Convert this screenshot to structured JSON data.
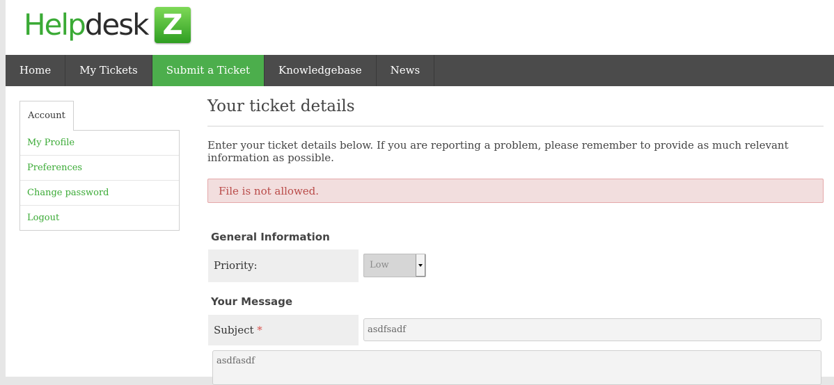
{
  "logo": {
    "part1": "Help",
    "part2": "desk",
    "badge": "Z"
  },
  "nav": {
    "items": [
      {
        "label": "Home"
      },
      {
        "label": "My Tickets"
      },
      {
        "label": "Submit a Ticket"
      },
      {
        "label": "Knowledgebase"
      },
      {
        "label": "News"
      }
    ],
    "active_color": "#4cae4c"
  },
  "sidebar": {
    "tab_label": "Account",
    "items": [
      {
        "label": "My Profile"
      },
      {
        "label": "Preferences"
      },
      {
        "label": "Change password"
      },
      {
        "label": "Logout"
      }
    ]
  },
  "main": {
    "title": "Your ticket details",
    "intro": "Enter your ticket details below. If you are reporting a problem, please remember to provide as much relevant information as possible.",
    "alert": "File is not allowed.",
    "general_heading": "General Information",
    "priority_label": "Priority:",
    "priority_value": "Low",
    "message_heading": "Your Message",
    "subject_label": "Subject",
    "required_mark": "*",
    "subject_value": "asdfsadf",
    "message_value": "asdfasdf"
  }
}
